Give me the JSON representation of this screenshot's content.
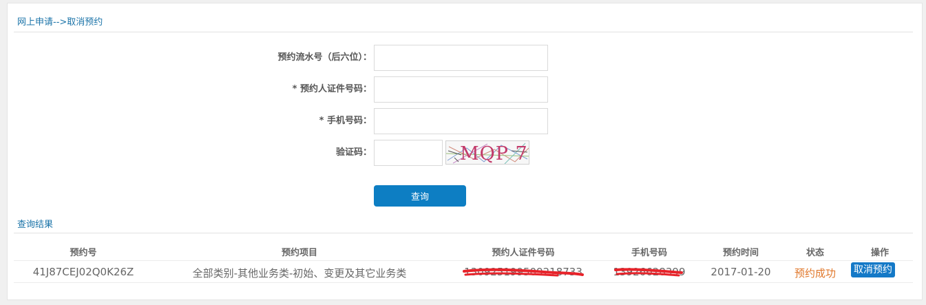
{
  "breadcrumb": "网上申请-->取消预约",
  "form": {
    "serial_label": "预约流水号（后六位）：",
    "serial_value": "",
    "id_label": "* 预约人证件号码：",
    "id_value": "",
    "phone_label": "* 手机号码：",
    "phone_value": "",
    "captcha_label": "验证码：",
    "captcha_value": "",
    "captcha_text": "MQP 7",
    "query_button": "查询"
  },
  "results": {
    "title": "查询结果",
    "columns": [
      "预约号",
      "预约项目",
      "预约人证件号码",
      "手机号码",
      "预约时间",
      "状态",
      "操作"
    ],
    "rows": [
      {
        "appointment_no": "41J87CEJ02Q0K26Z",
        "item": "全部类别-其他业务类-初始、变更及其它业务类",
        "id_number": "130925199509218733",
        "phone": "13926628399",
        "time": "2017-01-20",
        "status": "预约成功",
        "action": "取消预约"
      }
    ]
  },
  "colors": {
    "link": "#1a73a8",
    "primary": "#0d7ec3",
    "success_status": "#e0772a",
    "redaction": "#e8232a"
  }
}
